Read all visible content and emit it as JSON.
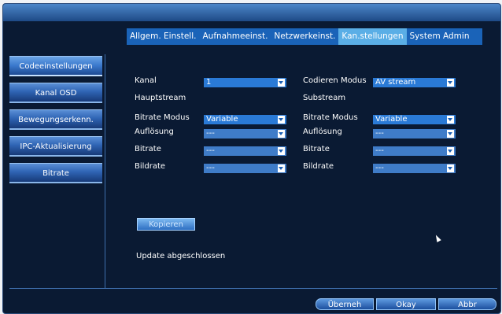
{
  "tabs": [
    "Allgem. Einstell.",
    "Aufnahmeeinst.",
    "Netzwerkeinst.",
    "Kan.stellungen",
    "System Admin"
  ],
  "active_tab": "Kan.stellungen",
  "sidebar": [
    {
      "label": "Codeeinstellungen",
      "active": true
    },
    {
      "label": "Kanal OSD",
      "active": false
    },
    {
      "label": "Bewegungserkenn.",
      "active": false
    },
    {
      "label": "IPC-Aktualisierung",
      "active": false
    },
    {
      "label": "Bitrate",
      "active": false
    }
  ],
  "form": {
    "kanal_label": "Kanal",
    "kanal_value": "1",
    "codieren_label": "Codieren Modus",
    "codieren_value": "AV stream",
    "main_header": "Hauptstream",
    "sub_header": "Substream",
    "main": {
      "bitrate_modus_label": "Bitrate Modus",
      "bitrate_modus_value": "Variable",
      "aufloesung_label": "Auflösung",
      "aufloesung_value": "---",
      "bitrate_label": "Bitrate",
      "bitrate_value": "---",
      "bildrate_label": "Bildrate",
      "bildrate_value": "---"
    },
    "sub": {
      "bitrate_modus_label": "Bitrate Modus",
      "bitrate_modus_value": "Variable",
      "aufloesung_label": "Auflösung",
      "aufloesung_value": "---",
      "bitrate_label": "Bitrate",
      "bitrate_value": "---",
      "bildrate_label": "Bildrate",
      "bildrate_value": "---"
    }
  },
  "copy_button": "Kopieren",
  "status_text": "Update abgeschlossen",
  "bottom_buttons": {
    "apply": "Überneh",
    "ok": "Okay",
    "cancel": "Abbr"
  },
  "colors": {
    "background": "#0a1a33",
    "tab_bar": "#1a63b8",
    "active_tab": "#5aaee6",
    "dropdown": "#2a7ad6"
  }
}
